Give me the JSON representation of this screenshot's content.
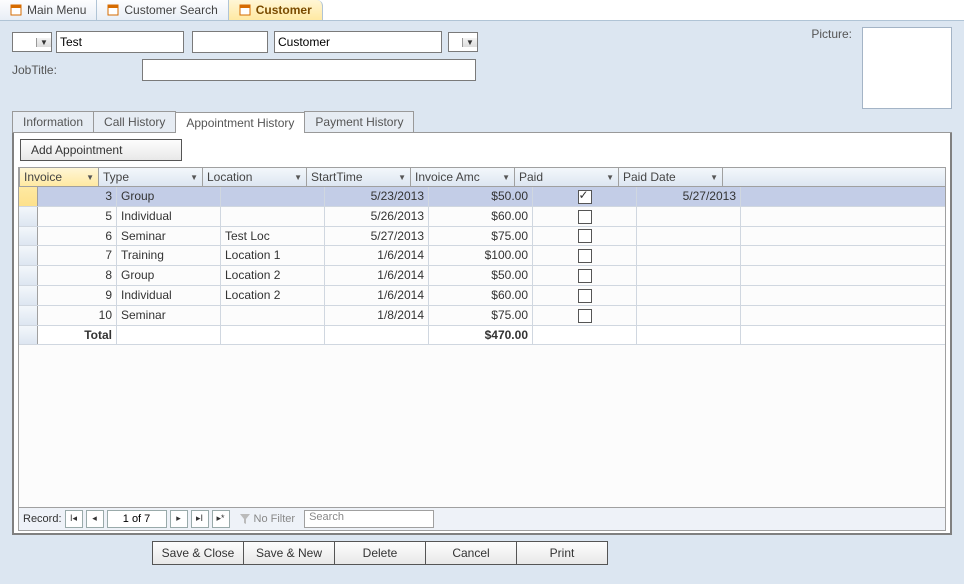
{
  "window_tabs": [
    {
      "label": "Main Menu",
      "active": false
    },
    {
      "label": "Customer Search",
      "active": false
    },
    {
      "label": "Customer",
      "active": true
    }
  ],
  "form": {
    "first_name": "Test",
    "middle": "",
    "last_name": "Customer",
    "job_title_label": "JobTitle:",
    "job_title": "",
    "picture_label": "Picture:"
  },
  "sub_tabs": [
    {
      "label": "Information",
      "active": false
    },
    {
      "label": "Call History",
      "active": false
    },
    {
      "label": "Appointment History",
      "active": true
    },
    {
      "label": "Payment History",
      "active": false
    }
  ],
  "add_appointment_label": "Add Appointment",
  "columns": {
    "invoice": "Invoice",
    "type": "Type",
    "location": "Location",
    "start_time": "StartTime",
    "amount": "Invoice Amc",
    "paid": "Paid",
    "paid_date": "Paid Date"
  },
  "rows": [
    {
      "invoice": "3",
      "type": "Group",
      "location": "",
      "start": "5/23/2013",
      "amount": "$50.00",
      "paid": true,
      "paid_date": "5/27/2013",
      "selected": true
    },
    {
      "invoice": "5",
      "type": "Individual",
      "location": "",
      "start": "5/26/2013",
      "amount": "$60.00",
      "paid": false,
      "paid_date": ""
    },
    {
      "invoice": "6",
      "type": "Seminar",
      "location": "Test Loc",
      "start": "5/27/2013",
      "amount": "$75.00",
      "paid": false,
      "paid_date": ""
    },
    {
      "invoice": "7",
      "type": "Training",
      "location": "Location 1",
      "start": "1/6/2014",
      "amount": "$100.00",
      "paid": false,
      "paid_date": ""
    },
    {
      "invoice": "8",
      "type": "Group",
      "location": "Location 2",
      "start": "1/6/2014",
      "amount": "$50.00",
      "paid": false,
      "paid_date": ""
    },
    {
      "invoice": "9",
      "type": "Individual",
      "location": "Location 2",
      "start": "1/6/2014",
      "amount": "$60.00",
      "paid": false,
      "paid_date": ""
    },
    {
      "invoice": "10",
      "type": "Seminar",
      "location": "",
      "start": "1/8/2014",
      "amount": "$75.00",
      "paid": false,
      "paid_date": ""
    }
  ],
  "total_label": "Total",
  "total_amount": "$470.00",
  "record_nav": {
    "label": "Record:",
    "position": "1 of 7",
    "no_filter": "No Filter",
    "search_placeholder": "Search"
  },
  "buttons": {
    "save_close": "Save & Close",
    "save_new": "Save & New",
    "delete": "Delete",
    "cancel": "Cancel",
    "print": "Print"
  }
}
